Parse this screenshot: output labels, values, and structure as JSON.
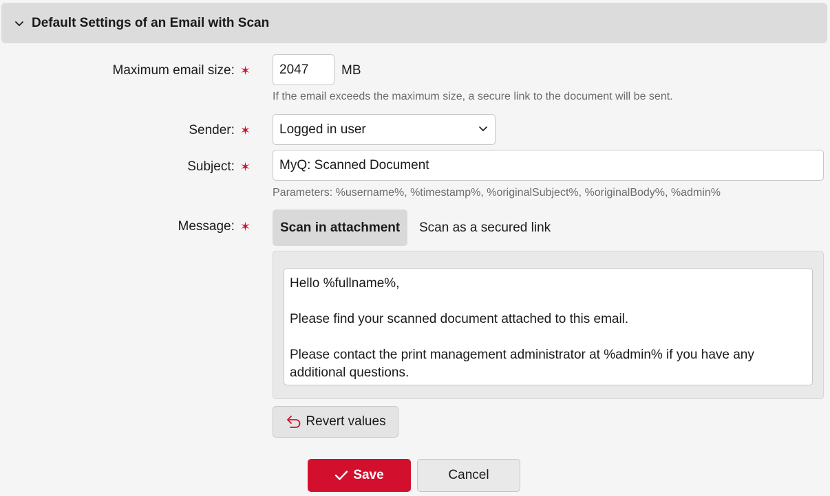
{
  "section": {
    "title": "Default Settings of an Email with Scan",
    "collapse_icon": "chevron-down-icon"
  },
  "max_size": {
    "label": "Maximum email size:",
    "required_mark": "✶",
    "value": "2047",
    "unit": "MB",
    "hint": "If the email exceeds the maximum size, a secure link to the document will be sent."
  },
  "sender": {
    "label": "Sender:",
    "required_mark": "✶",
    "selected": "Logged in user"
  },
  "subject": {
    "label": "Subject:",
    "required_mark": "✶",
    "value": "MyQ: Scanned Document",
    "hint": "Parameters: %username%, %timestamp%, %originalSubject%, %originalBody%, %admin%"
  },
  "message": {
    "label": "Message:",
    "required_mark": "✶",
    "tabs": [
      {
        "label": "Scan in attachment",
        "active": true
      },
      {
        "label": "Scan as a secured link",
        "active": false
      }
    ],
    "body_lines": [
      "Hello %fullname%,",
      "Please find your scanned document attached to this email.",
      "Please contact the print management administrator at %admin% if you have any additional questions."
    ]
  },
  "actions": {
    "revert_label": "Revert values",
    "save_label": "Save",
    "cancel_label": "Cancel"
  },
  "colors": {
    "accent": "#d2102e",
    "required": "#c8102e"
  }
}
